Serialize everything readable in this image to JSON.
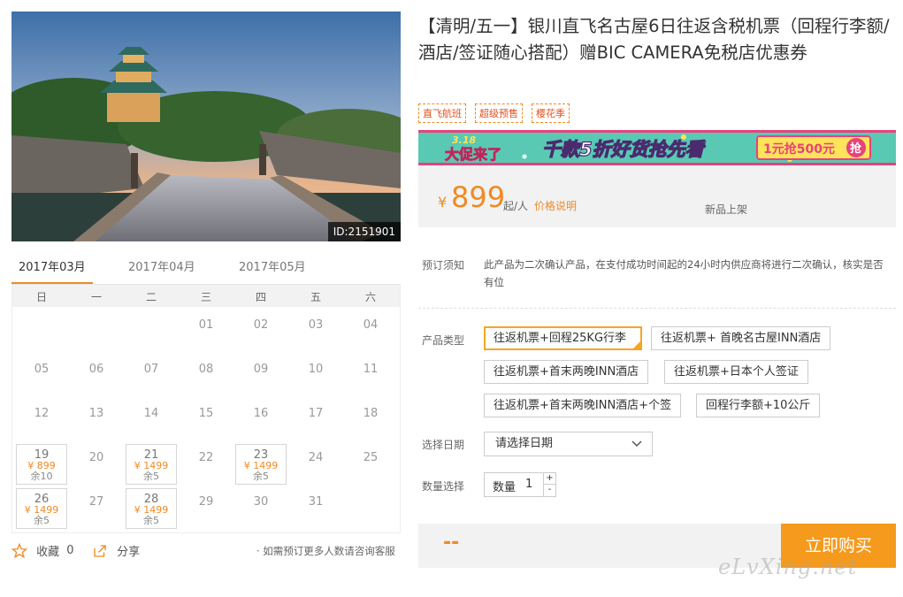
{
  "photo": {
    "id_label": "ID:2151901"
  },
  "calendar": {
    "months": [
      "2017年03月",
      "2017年04月",
      "2017年05月"
    ],
    "weekdays": [
      "日",
      "一",
      "二",
      "三",
      "四",
      "五",
      "六"
    ],
    "rows": [
      [
        null,
        null,
        null,
        {
          "d": "01"
        },
        {
          "d": "02"
        },
        {
          "d": "03"
        },
        {
          "d": "04"
        }
      ],
      [
        {
          "d": "05"
        },
        {
          "d": "06"
        },
        {
          "d": "07"
        },
        {
          "d": "08"
        },
        {
          "d": "09"
        },
        {
          "d": "10"
        },
        {
          "d": "11"
        }
      ],
      [
        {
          "d": "12"
        },
        {
          "d": "13"
        },
        {
          "d": "14"
        },
        {
          "d": "15"
        },
        {
          "d": "16"
        },
        {
          "d": "17"
        },
        {
          "d": "18"
        }
      ],
      [
        {
          "d": "19",
          "price": "¥ 899",
          "stock": "余10"
        },
        {
          "d": "20"
        },
        {
          "d": "21",
          "price": "¥ 1499",
          "stock": "余5"
        },
        {
          "d": "22"
        },
        {
          "d": "23",
          "price": "¥ 1499",
          "stock": "余5"
        },
        {
          "d": "24"
        },
        {
          "d": "25"
        }
      ],
      [
        {
          "d": "26",
          "price": "¥ 1499",
          "stock": "余5"
        },
        {
          "d": "27"
        },
        {
          "d": "28",
          "price": "¥ 1499",
          "stock": "余5"
        },
        {
          "d": "29"
        },
        {
          "d": "30"
        },
        {
          "d": "31"
        },
        null
      ]
    ]
  },
  "actions": {
    "favorite_label": "收藏",
    "favorite_count": "0",
    "share_label": "分享",
    "consult_text": "· 如需预订更多人数请咨询客服"
  },
  "product": {
    "title": "【清明/五一】银川直飞名古屋6日往返含税机票（回程行李额/酒店/签证随心搭配）赠BIC CAMERA免税店优惠券",
    "tags": [
      "直飞航班",
      "超级预售",
      "樱花季"
    ]
  },
  "banner": {
    "badge_top": "3.18",
    "badge_bottom": "大促来了",
    "headline": "千款5折好货抢先看",
    "coupon": "1元抢500元",
    "coupon_action": "抢"
  },
  "price": {
    "currency": "¥",
    "amount": "899",
    "unit": "起/人",
    "note_link": "价格说明",
    "status": "新品上架"
  },
  "notice": {
    "label": "预订须知",
    "text": "此产品为二次确认产品，在支付成功时间起的24小时内供应商将进行二次确认，核实是否有位"
  },
  "options": {
    "label": "产品类型",
    "items": [
      "往返机票+回程25KG行李",
      "往返机票+ 首晚名古屋INN酒店",
      "往返机票+首末两晚INN酒店",
      "往返机票+日本个人签证",
      "往返机票+首末两晚INN酒店+个签",
      "回程行李额+10公斤"
    ],
    "selected_index": 0
  },
  "date_picker": {
    "label": "选择日期",
    "placeholder": "请选择日期"
  },
  "quantity": {
    "label": "数量选择",
    "inner_label": "数量",
    "value": "1",
    "plus": "+",
    "minus": "-"
  },
  "checkout": {
    "total": "--",
    "buy_label": "立即购买"
  },
  "watermark": "eLvXing.net",
  "colors": {
    "accent": "#f08a24",
    "buy_button": "#f59a1d",
    "tag_text": "#e4501d"
  }
}
